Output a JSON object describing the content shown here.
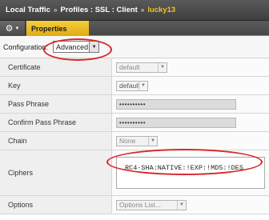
{
  "breadcrumb": {
    "items": [
      "Local Traffic",
      "Profiles : SSL : Client"
    ],
    "separator": "»",
    "current": "lucky13"
  },
  "tabs": {
    "properties_label": "Properties"
  },
  "configuration": {
    "label": "Configuration:",
    "value": "Advanced"
  },
  "form": {
    "certificate": {
      "label": "Certificate",
      "value": "default"
    },
    "key": {
      "label": "Key",
      "value": "default"
    },
    "pass_phrase": {
      "label": "Pass Phrase",
      "value": "••••••••••"
    },
    "confirm_pass_phrase": {
      "label": "Confirm Pass Phrase",
      "value": "••••••••••"
    },
    "chain": {
      "label": "Chain",
      "value": "None"
    },
    "ciphers": {
      "label": "Ciphers",
      "value": "RC4-SHA:NATIVE:!EXP:!MD5:!DES"
    },
    "options": {
      "label": "Options",
      "value": "Options List..."
    }
  },
  "colors": {
    "header_bg": "#4a4a4a",
    "active_crumb": "#f0c419",
    "tab_active": "#e8b820",
    "annotation": "#d6272a"
  }
}
